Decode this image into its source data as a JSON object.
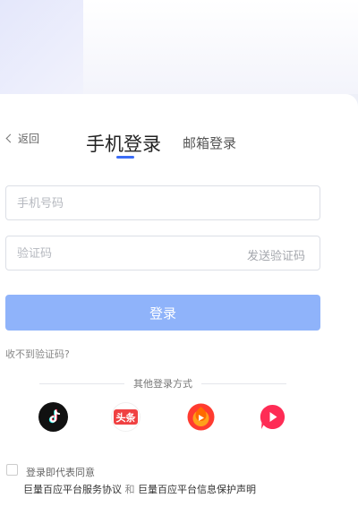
{
  "header": {
    "back_label": "返回",
    "tab_phone": "手机登录",
    "tab_email": "邮箱登录"
  },
  "form": {
    "phone_placeholder": "手机号码",
    "code_placeholder": "验证码",
    "send_code_label": "发送验证码",
    "login_label": "登录",
    "no_code_label": "收不到验证码?"
  },
  "other_login": {
    "title": "其他登录方式",
    "providers": [
      "douyin-icon",
      "toutiao-icon",
      "xigua-icon",
      "huoshan-icon"
    ],
    "toutiao_text": "头条"
  },
  "agreement": {
    "prefix": "登录即代表同意",
    "link_service": "巨量百应平台服务协议",
    "and": "和",
    "link_privacy": "巨量百应平台信息保护声明"
  },
  "colors": {
    "accent": "#3b6cf6",
    "login_button": "#8fb3fa",
    "toutiao_red": "#f04142",
    "xigua_red": "#fe2c55"
  }
}
